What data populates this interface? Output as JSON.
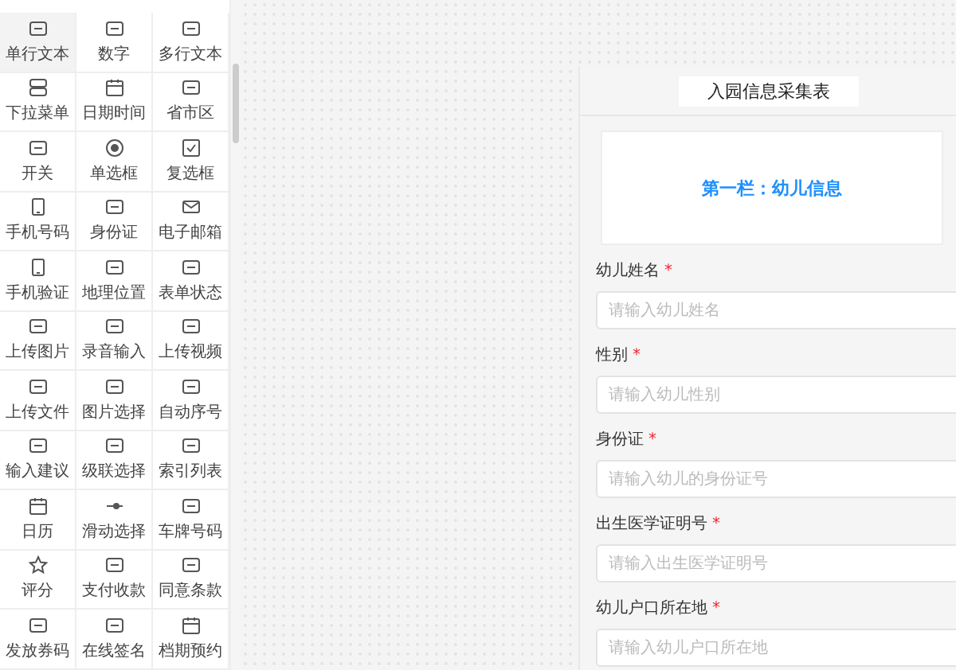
{
  "palette": [
    {
      "label": "单行文本",
      "selected": true
    },
    {
      "label": "数字",
      "selected": false
    },
    {
      "label": "多行文本",
      "selected": false
    },
    {
      "label": "下拉菜单",
      "selected": false
    },
    {
      "label": "日期时间",
      "selected": false
    },
    {
      "label": "省市区",
      "selected": false
    },
    {
      "label": "开关",
      "selected": false
    },
    {
      "label": "单选框",
      "selected": false
    },
    {
      "label": "复选框",
      "selected": false
    },
    {
      "label": "手机号码",
      "selected": false
    },
    {
      "label": "身份证",
      "selected": false
    },
    {
      "label": "电子邮箱",
      "selected": false
    },
    {
      "label": "手机验证",
      "selected": false
    },
    {
      "label": "地理位置",
      "selected": false
    },
    {
      "label": "表单状态",
      "selected": false
    },
    {
      "label": "上传图片",
      "selected": false
    },
    {
      "label": "录音输入",
      "selected": false
    },
    {
      "label": "上传视频",
      "selected": false
    },
    {
      "label": "上传文件",
      "selected": false
    },
    {
      "label": "图片选择",
      "selected": false
    },
    {
      "label": "自动序号",
      "selected": false
    },
    {
      "label": "输入建议",
      "selected": false
    },
    {
      "label": "级联选择",
      "selected": false
    },
    {
      "label": "索引列表",
      "selected": false
    },
    {
      "label": "日历",
      "selected": false
    },
    {
      "label": "滑动选择",
      "selected": false
    },
    {
      "label": "车牌号码",
      "selected": false
    },
    {
      "label": "评分",
      "selected": false
    },
    {
      "label": "支付收款",
      "selected": false
    },
    {
      "label": "同意条款",
      "selected": false
    },
    {
      "label": "发放券码",
      "selected": false
    },
    {
      "label": "在线签名",
      "selected": false
    },
    {
      "label": "档期预约",
      "selected": false
    }
  ],
  "preview": {
    "title": "入园信息采集表",
    "section": "第一栏：幼儿信息",
    "fields": [
      {
        "label": "幼儿姓名",
        "required_mark": "*",
        "placeholder": "请输入幼儿姓名"
      },
      {
        "label": "性别",
        "required_mark": "*",
        "placeholder": "请输入幼儿性别"
      },
      {
        "label": "身份证",
        "required_mark": "*",
        "placeholder": "请输入幼儿的身份证号"
      },
      {
        "label": "出生医学证明号",
        "required_mark": "*",
        "placeholder": "请输入出生医学证明号"
      },
      {
        "label": "幼儿户口所在地",
        "required_mark": "*",
        "placeholder": "请输入幼儿户口所在地"
      }
    ]
  }
}
